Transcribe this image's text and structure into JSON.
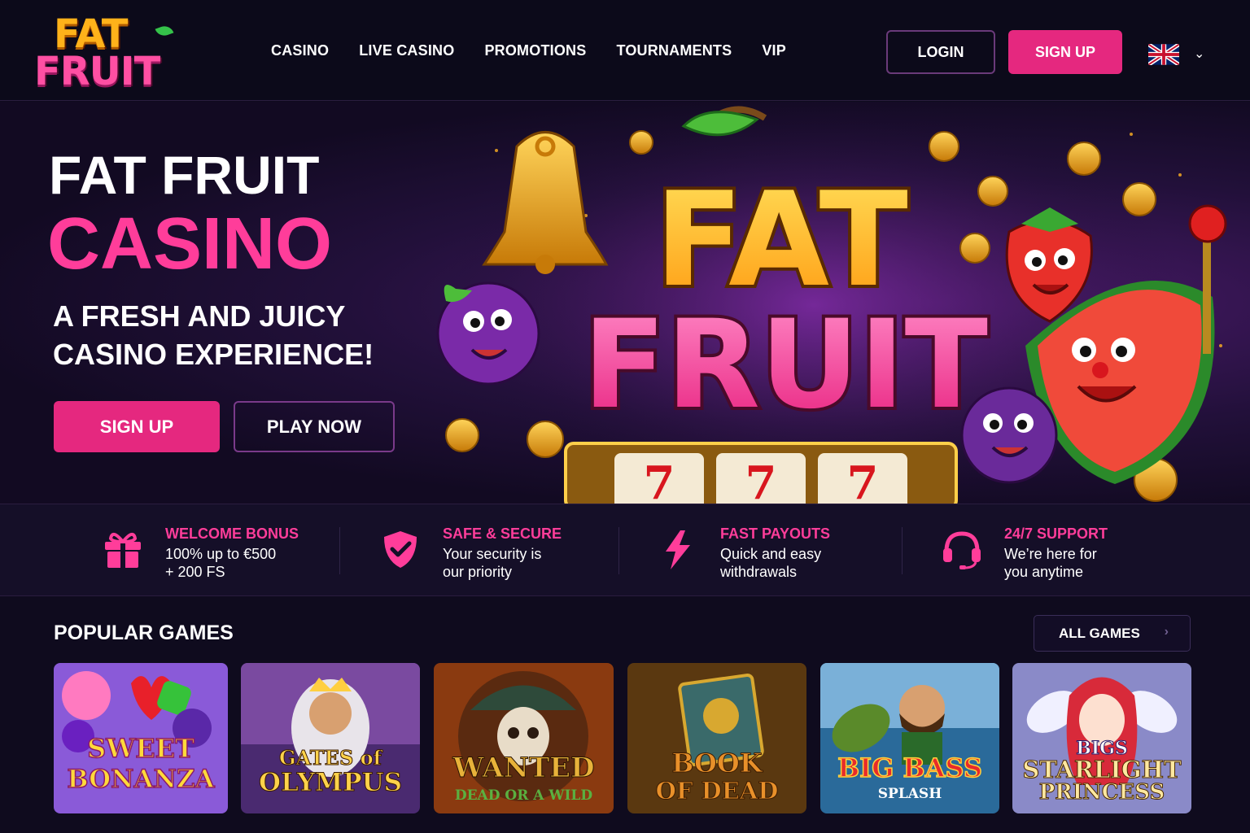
{
  "header": {
    "logo_top": "FAT",
    "logo_bottom": "FRUIT",
    "nav": [
      "CASINO",
      "LIVE CASINO",
      "PROMOTIONS",
      "TOURNAMENTS",
      "VIP"
    ],
    "login_label": "LOGIN",
    "signup_label": "SIGN UP",
    "language_icon": "uk-flag-icon"
  },
  "hero": {
    "title_line1": "FAT FRUIT",
    "title_line2": "CASINO",
    "subtitle": "A FRESH AND JUICY CASINO EXPERIENCE!",
    "signup_label": "SIGN UP",
    "play_label": "PLAY NOW",
    "art_logo_top": "FAT",
    "art_logo_bottom": "FRUIT",
    "reel_symbols": [
      "7",
      "7",
      "7"
    ]
  },
  "features": [
    {
      "icon": "gift-icon",
      "title": "WELCOME BONUS",
      "desc_1": "100% up to €500",
      "desc_2": "+ 200 FS"
    },
    {
      "icon": "shield-check-icon",
      "title": "SAFE & SECURE",
      "desc_1": "Your security is",
      "desc_2": "our priority"
    },
    {
      "icon": "lightning-icon",
      "title": "FAST PAYOUTS",
      "desc_1": "Quick and easy",
      "desc_2": "withdrawals"
    },
    {
      "icon": "headset-icon",
      "title": "24/7 SUPPORT",
      "desc_1": "We’re here for",
      "desc_2": "you anytime"
    }
  ],
  "popular": {
    "title": "POPULAR GAMES",
    "all_games_label": "ALL GAMES",
    "games": [
      {
        "line1": "SWEET",
        "line2": "BONANZA",
        "line3": ""
      },
      {
        "line1": "GATES of",
        "line2": "OLYMPUS",
        "line3": ""
      },
      {
        "line1": "WANTED",
        "line2": "DEAD OR A WILD",
        "line3": ""
      },
      {
        "line1": "BOOK",
        "line2": "OF DEAD",
        "line3": ""
      },
      {
        "line1": "BIG BASS",
        "line2": "SPLASH",
        "line3": ""
      },
      {
        "line1": "BIGS",
        "line2": "STARLIGHT",
        "line3": "PRINCESS"
      }
    ]
  },
  "colors": {
    "accent": "#e5287f",
    "accent_text": "#ff3d9a",
    "background": "#0f0b1e"
  }
}
